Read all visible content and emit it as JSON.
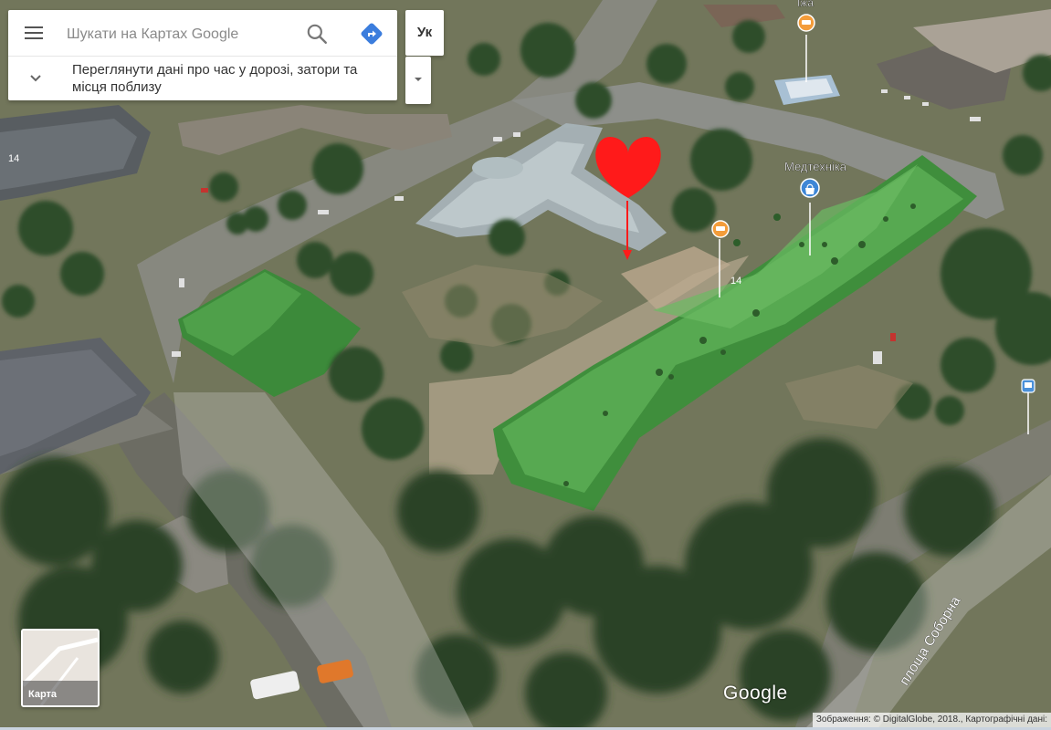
{
  "search": {
    "placeholder": "Шукати на Картах Google"
  },
  "traffic": {
    "text": "Переглянути дані про час у дорозі, затори та місця поблизу"
  },
  "language": {
    "label": "Ук"
  },
  "map": {
    "poi_top": "Їжа",
    "poi_medtech": "Медтехніка",
    "building_number_left": "14",
    "building_number_main": "14",
    "street_name": "площа Соборна",
    "brand": "Google",
    "attribution": "Зображення: © DigitalGlobe, 2018., Картографічні дані:"
  },
  "minimap": {
    "label": "Карта"
  },
  "colors": {
    "roof_green": "#4f9a46",
    "marker_orange": "#f39c3a",
    "marker_blue": "#3d86d6",
    "heart_red": "#ff1a1a"
  }
}
